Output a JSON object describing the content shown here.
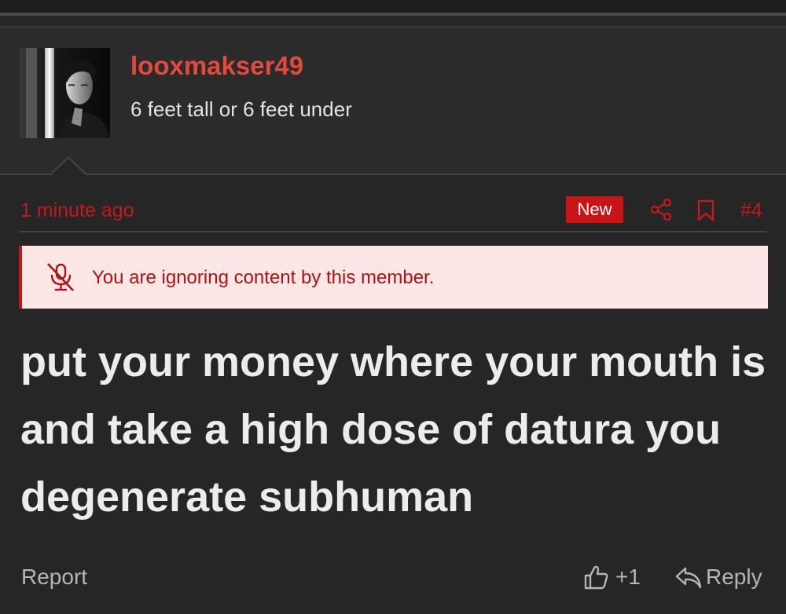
{
  "post": {
    "author": {
      "username": "looxmakser49",
      "user_title": "6 feet tall or 6 feet under",
      "avatar_icon": "user-avatar-photo"
    },
    "timestamp": "1 minute ago",
    "new_badge": "New",
    "post_number": "#4",
    "ignore_notice": "You are ignoring content by this member.",
    "body": "put your money where your mouth is and take a high dose of datura you degenerate subhuman",
    "actions": {
      "report_label": "Report",
      "like_count": "+1",
      "reply_label": "Reply"
    }
  },
  "colors": {
    "accent": "#c81414",
    "username": "#e24a3b",
    "background": "#262626",
    "notice_background": "#fde6e6"
  },
  "icons": [
    "share-icon",
    "bookmark-icon",
    "ignore-icon",
    "like-icon",
    "reply-icon"
  ]
}
